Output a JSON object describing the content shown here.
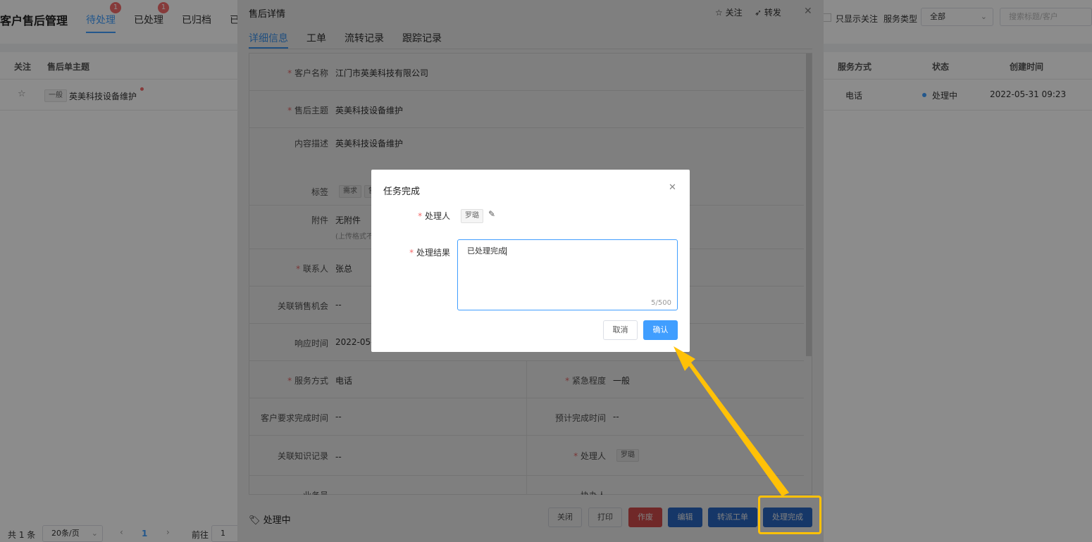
{
  "page": {
    "title": "客户售后管理",
    "tabs": [
      {
        "label": "待处理",
        "badge": "1"
      },
      {
        "label": "已处理",
        "badge": "1"
      },
      {
        "label": "已归档"
      },
      {
        "label": "已"
      }
    ],
    "only_follow": "只显示关注",
    "service_type_label": "服务类型",
    "service_type_value": "全部",
    "search_placeholder": "搜索标题/客户",
    "table": {
      "headers": [
        "关注",
        "售后单主题",
        "服务方式",
        "状态",
        "创建时间"
      ],
      "row": {
        "urgency": "一般",
        "subject": "英美科技设备维护",
        "service": "电话",
        "status": "处理中",
        "created": "2022-05-31 09:23"
      }
    },
    "pagination": {
      "total": "共 1 条",
      "page_size": "20条/页",
      "current": "1",
      "goto": "前往",
      "goto_value": "1"
    }
  },
  "drawer": {
    "title": "售后详情",
    "follow": "关注",
    "forward": "转发",
    "tabs": [
      "详细信息",
      "工单",
      "流转记录",
      "跟踪记录"
    ],
    "fields": {
      "customer_label": "客户名称",
      "customer_value": "江门市英美科技有限公司",
      "subject_label": "售后主题",
      "subject_value": "英美科技设备维护",
      "desc_label": "内容描述",
      "desc_value": "英美科技设备维护",
      "tags_label": "标签",
      "tag1": "需求",
      "tag2": "售",
      "attach_label": "附件",
      "attach_value": "无附件",
      "attach_hint": "(上传格式不",
      "contact_label": "联系人",
      "contact_value": "张总",
      "opportunity_label": "关联销售机会",
      "opportunity_value": "--",
      "response_label": "响应时间",
      "response_value": "2022-05-",
      "service_label": "服务方式",
      "service_value": "电话",
      "urgency_label": "紧急程度",
      "urgency_value": "一般",
      "cust_due_label": "客户要求完成时间",
      "cust_due_value": "--",
      "est_due_label": "预计完成时间",
      "est_due_value": "--",
      "knowledge_label": "关联知识记录",
      "knowledge_value": "--",
      "handler_label": "处理人",
      "handler_value": "罗璐",
      "biz_label": "业务员",
      "assist_label": "协办人"
    },
    "status": "处理中",
    "buttons": {
      "close": "关闭",
      "print": "打印",
      "void": "作废",
      "edit": "编辑",
      "transfer": "转派工单",
      "complete": "处理完成"
    }
  },
  "modal": {
    "title": "任务完成",
    "handler_label": "处理人",
    "handler_value": "罗璐",
    "result_label": "处理结果",
    "result_value": "已处理完成",
    "counter": "5/500",
    "cancel": "取消",
    "confirm": "确认"
  },
  "colors": {
    "primary": "#409eff",
    "blue_btn": "#2d6fd0",
    "danger": "#e05050",
    "highlight": "#ffc107"
  }
}
